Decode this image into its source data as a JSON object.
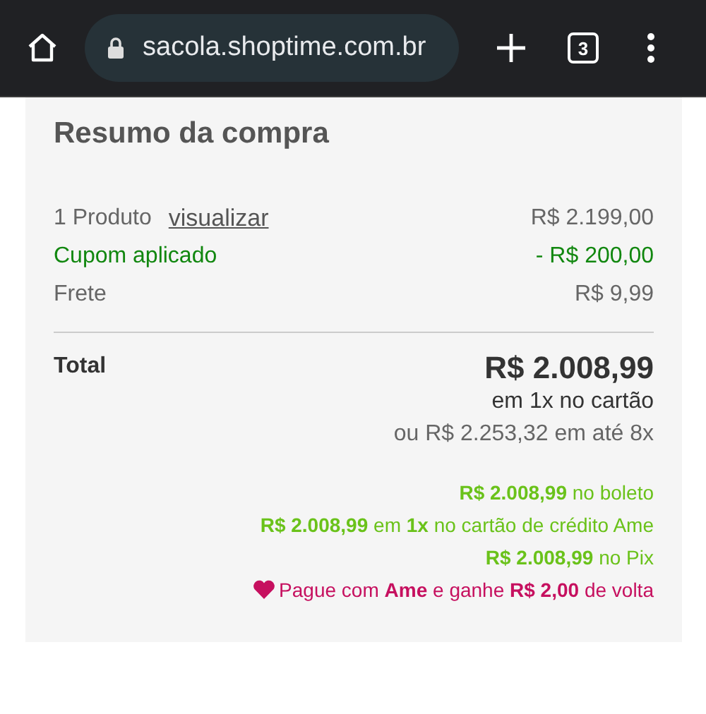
{
  "browser": {
    "url": "sacola.shoptime.com.br",
    "tab_count": "3"
  },
  "summary": {
    "title": "Resumo da compra",
    "lines": [
      {
        "kind": "product",
        "label": "1 Produto",
        "link": "visualizar",
        "value": "R$ 2.199,00"
      },
      {
        "kind": "discount",
        "label": "Cupom aplicado",
        "value": "- R$ 200,00"
      },
      {
        "kind": "normal",
        "label": "Frete",
        "value": "R$ 9,99"
      }
    ],
    "total": {
      "label": "Total",
      "value": "R$ 2.008,99",
      "installment": "em 1x no cartão",
      "alt": "ou R$ 2.253,32 em até 8x"
    },
    "offers": [
      {
        "kind": "green",
        "text": "**R$ 2.008,99** no boleto"
      },
      {
        "kind": "green",
        "text": "**R$ 2.008,99** em **1x** no cartão de crédito Ame"
      },
      {
        "kind": "green",
        "text": "**R$ 2.008,99** no Pix"
      },
      {
        "kind": "ame",
        "text": "Pague com **Ame** e ganhe **R$ 2,00** de volta"
      }
    ]
  }
}
